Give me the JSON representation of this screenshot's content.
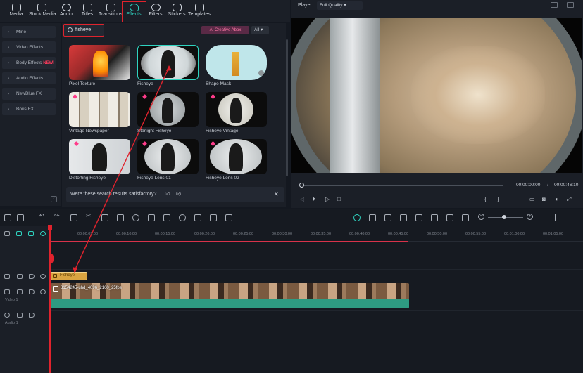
{
  "toolbar": {
    "tabs": [
      {
        "label": "Media"
      },
      {
        "label": "Stock Media"
      },
      {
        "label": "Audio"
      },
      {
        "label": "Titles"
      },
      {
        "label": "Transitions"
      },
      {
        "label": "Effects"
      },
      {
        "label": "Filters"
      },
      {
        "label": "Stickers"
      },
      {
        "label": "Templates"
      }
    ]
  },
  "sidebar": {
    "items": [
      {
        "label": "Mine"
      },
      {
        "label": "Video Effects"
      },
      {
        "label": "Body Effects",
        "badge": "NEW!"
      },
      {
        "label": "Audio Effects"
      },
      {
        "label": "NewBlue FX"
      },
      {
        "label": "Boris FX"
      }
    ]
  },
  "search": {
    "value": "fisheye"
  },
  "filters": {
    "ai_label": "AI Creative Abox",
    "all_label": "All"
  },
  "effects": [
    {
      "label": "Pixel Texture"
    },
    {
      "label": "Fisheye"
    },
    {
      "label": "Shape Mask"
    },
    {
      "label": "Vintage Newspaper"
    },
    {
      "label": "Starlight Fisheye"
    },
    {
      "label": "Fisheye Vintage"
    },
    {
      "label": "Distorting Fisheye"
    },
    {
      "label": "Fisheye Lens 01"
    },
    {
      "label": "Fisheye Lens 02"
    }
  ],
  "feedback": {
    "text": "Were these search results satisfactory?"
  },
  "player": {
    "label": "Player",
    "quality": "Full Quality",
    "time_current": "00:00:00:00",
    "time_sep": "/",
    "time_total": "00:00:46:10"
  },
  "timeline": {
    "ticks": [
      "00:00:05:00",
      "00:00:10:00",
      "00:00:15:00",
      "00:00:20:00",
      "00:00:25:00",
      "00:00:30:00",
      "00:00:35:00",
      "00:00:40:00",
      "00:00:45:00",
      "00:00:50:00",
      "00:00:55:00",
      "00:01:00:00",
      "00:01:05:00"
    ],
    "track_labels": {
      "video": "Video 1",
      "audio": "Audio 1"
    },
    "effect_clip": "Fisheye",
    "video_clip": "3154245-uhd_4096_2160_25fps"
  },
  "colors": {
    "accent": "#2fd3c0",
    "highlight": "#e0232d",
    "clip_effect": "#d9a441",
    "clip_audio": "#2e9b82"
  }
}
